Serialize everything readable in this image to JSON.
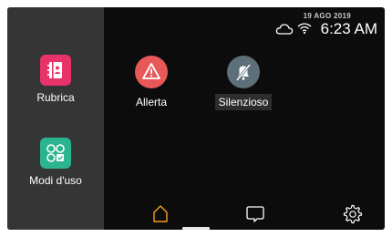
{
  "status": {
    "date": "19 AGO 2019",
    "time": "6:23 AM",
    "icons": [
      "cloud-icon",
      "wifi-icon"
    ]
  },
  "sidebar": {
    "items": [
      {
        "label": "Rubrica",
        "icon": "contacts-book-icon",
        "color": "#e8336a"
      },
      {
        "label": "Modi d'uso",
        "icon": "modes-grid-icon",
        "color": "#2bb58f"
      }
    ]
  },
  "apps": [
    {
      "label": "Allerta",
      "icon": "alert-triangle-icon",
      "color": "#e85858"
    },
    {
      "label": "Silenzioso",
      "icon": "mute-bell-icon",
      "color": "#5d6f79"
    }
  ],
  "navbar": {
    "items": [
      {
        "name": "home",
        "icon": "home-icon",
        "active": true
      },
      {
        "name": "messages",
        "icon": "chat-bubble-icon",
        "active": false
      },
      {
        "name": "settings",
        "icon": "gear-icon",
        "active": false
      }
    ],
    "accent": "#f2a020"
  },
  "colors": {
    "background": "#0c0c0c",
    "sidebar": "#353535",
    "text": "#ffffff"
  }
}
